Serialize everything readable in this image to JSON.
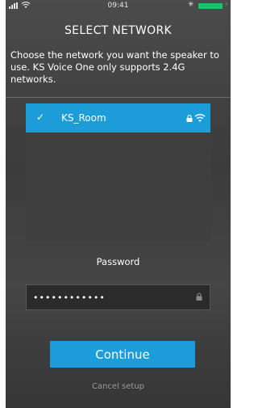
{
  "status_bar": {
    "time": "09:41",
    "bluetooth_icon": "bluetooth-icon",
    "colors": {
      "battery": "#19c36e"
    }
  },
  "screen": {
    "title": "SELECT NETWORK",
    "description": "Choose the network you want the speaker to use. KS Voice One only supports 2.4G networks."
  },
  "networks": [
    {
      "name": "KS_Room",
      "selected": true,
      "secured": true,
      "icons": [
        "checkmark-icon",
        "lock-icon",
        "wifi-icon"
      ]
    }
  ],
  "password": {
    "label": "Password",
    "value": "••••••••••••"
  },
  "buttons": {
    "continue_label": "Continue",
    "cancel_label": "Cancel setup"
  },
  "colors": {
    "accent": "#1c9cd8",
    "background": "#424242"
  }
}
